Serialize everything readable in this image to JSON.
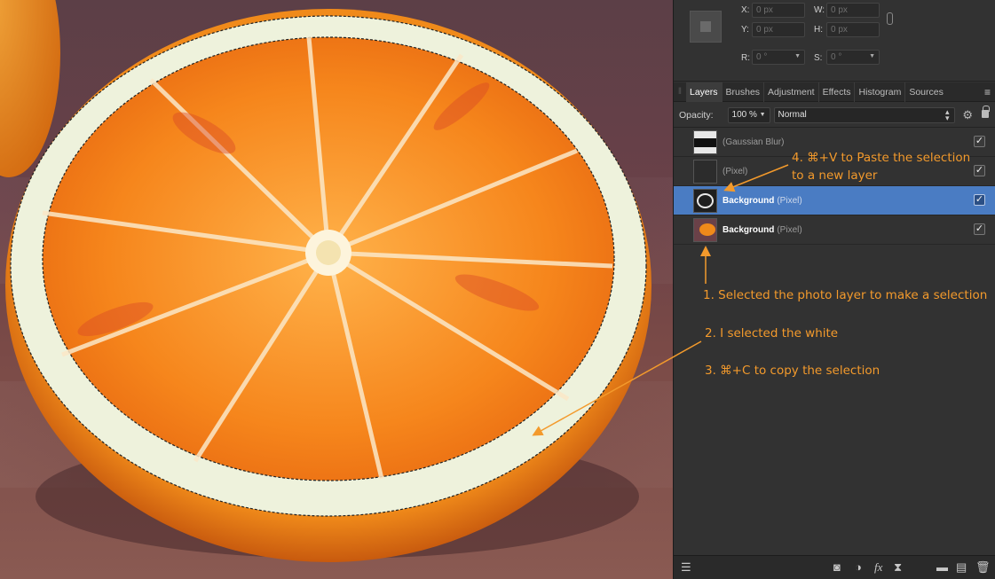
{
  "transform": {
    "x_label": "X:",
    "x_value": "0 px",
    "y_label": "Y:",
    "y_value": "0 px",
    "w_label": "W:",
    "w_value": "0 px",
    "h_label": "H:",
    "h_value": "0 px",
    "r_label": "R:",
    "r_value": "0 °",
    "s_label": "S:",
    "s_value": "0 °"
  },
  "tabs": [
    {
      "label": "Layers",
      "active": true
    },
    {
      "label": "Brushes"
    },
    {
      "label": "Adjustment"
    },
    {
      "label": "Effects"
    },
    {
      "label": "Histogram"
    },
    {
      "label": "Sources"
    }
  ],
  "opacity": {
    "label": "Opacity:",
    "value": "100 %",
    "blend_mode": "Normal"
  },
  "layers": [
    {
      "name": "",
      "type": "(Gaussian Blur)",
      "visible": true,
      "selected": false
    },
    {
      "name": "",
      "type": "(Pixel)",
      "visible": true,
      "selected": false
    },
    {
      "name": "Background",
      "type": "(Pixel)",
      "visible": true,
      "selected": true
    },
    {
      "name": "Background",
      "type": "(Pixel)",
      "visible": true,
      "selected": false
    }
  ],
  "annotations": {
    "step1": "1. Selected the photo layer to make a selection",
    "step2": "2. I selected the white",
    "step3": "3. ⌘+C to copy the selection",
    "step4_line1": "4. ⌘+V to Paste the selection",
    "step4_line2": "to a new layer"
  },
  "colors": {
    "accent": "#4a7cc3",
    "annotation": "#f39a2c",
    "panel_bg": "#323232"
  }
}
